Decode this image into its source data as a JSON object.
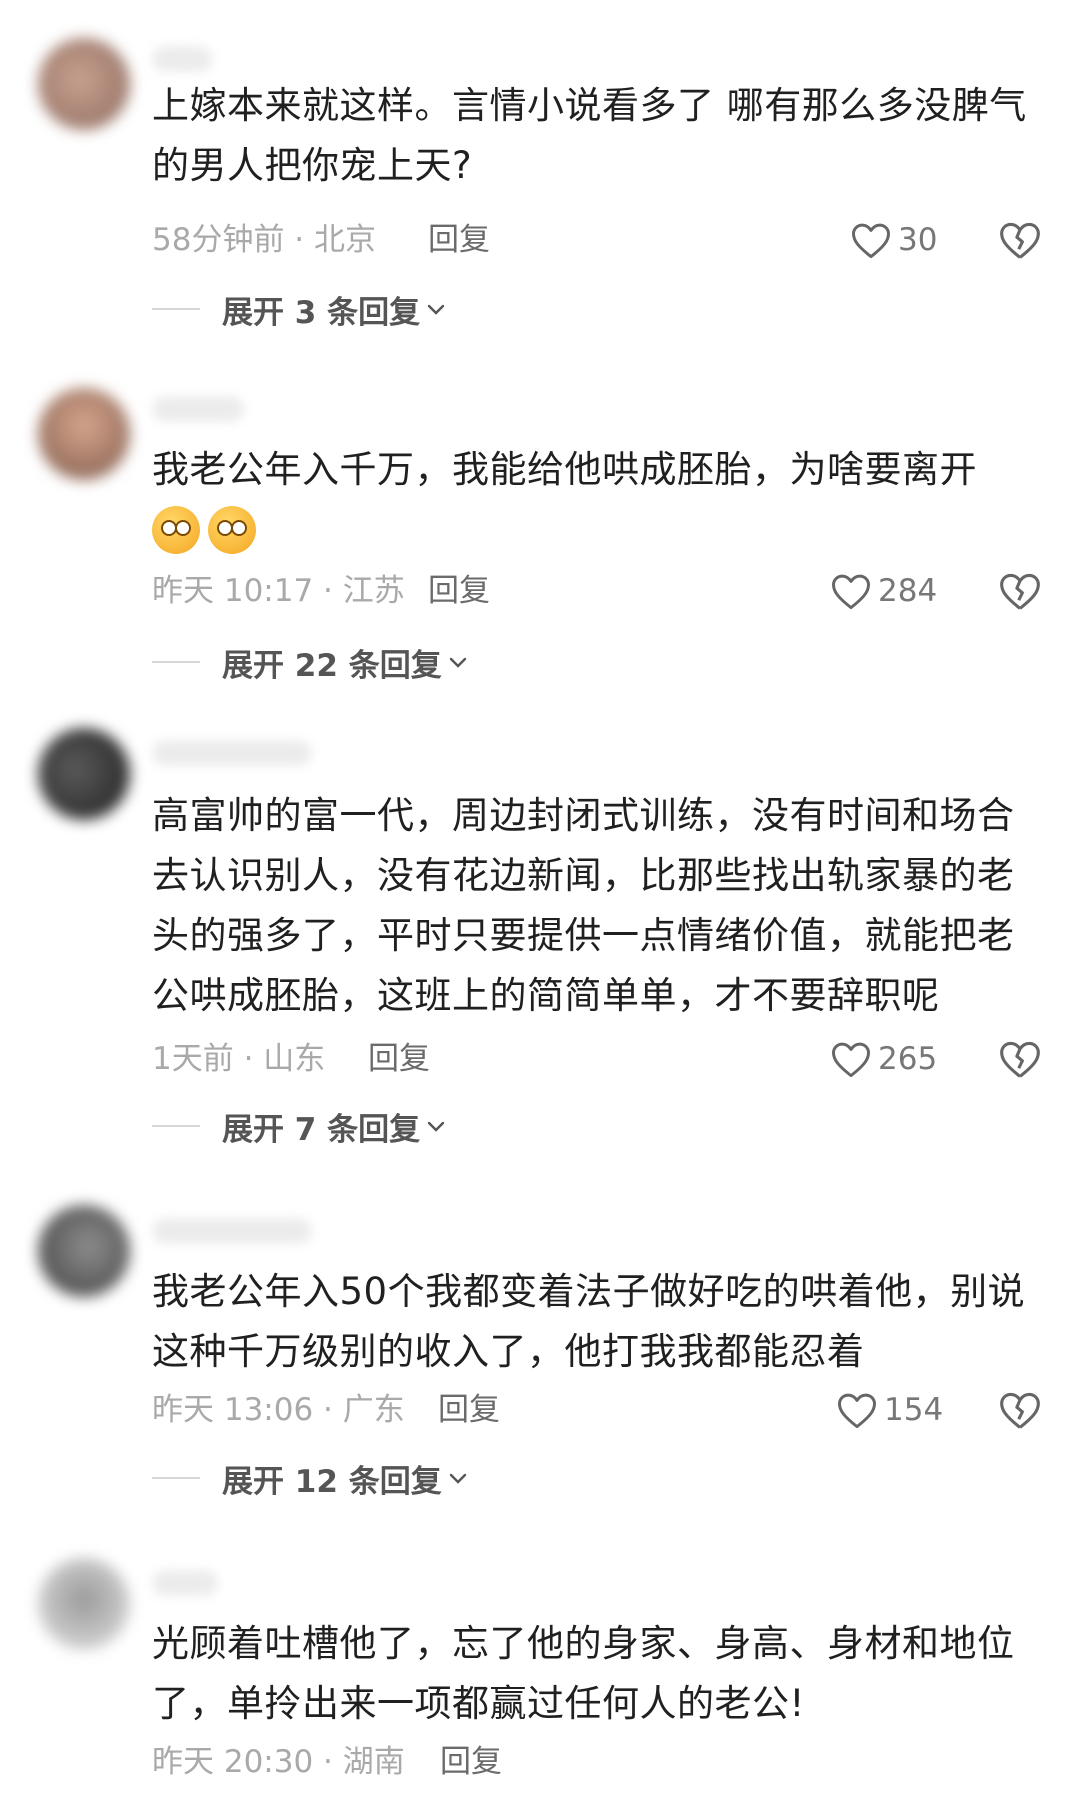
{
  "comments": [
    {
      "text": "上嫁本来就这样。言情小说看多了 哪有那么多没脾气的男人把你宠上天?",
      "time_location": "58分钟前 · 北京",
      "reply_label": "回复",
      "like_count": "30",
      "expand_label": "展开 3 条回复"
    },
    {
      "text": "我老公年入千万，我能给他哄成胚胎，为啥要离开",
      "emoji_count": 2,
      "time_location": "昨天 10:17 · 江苏",
      "reply_label": "回复",
      "like_count": "284",
      "expand_label": "展开 22 条回复"
    },
    {
      "text": "高富帅的富一代，周边封闭式训练，没有时间和场合去认识别人，没有花边新闻，比那些找出轨家暴的老头的强多了，平时只要提供一点情绪价值，就能把老公哄成胚胎，这班上的简简单单，才不要辞职呢",
      "time_location": "1天前 · 山东",
      "reply_label": "回复",
      "like_count": "265",
      "expand_label": "展开 7 条回复"
    },
    {
      "text": "我老公年入50个我都变着法子做好吃的哄着他，别说这种千万级别的收入了，他打我我都能忍着",
      "time_location": "昨天 13:06 · 广东",
      "reply_label": "回复",
      "like_count": "154",
      "expand_label": "展开 12 条回复"
    },
    {
      "text": "光顾着吐槽他了，忘了他的身家、身高、身材和地位了，单拎出来一项都赢过任何人的老公!",
      "time_location": "昨天 20:30 · 湖南",
      "reply_label": "回复"
    }
  ],
  "colors": {
    "text": "#202020",
    "meta": "#a9a9a9",
    "reply": "#6b6b6b",
    "icon": "#666666"
  }
}
